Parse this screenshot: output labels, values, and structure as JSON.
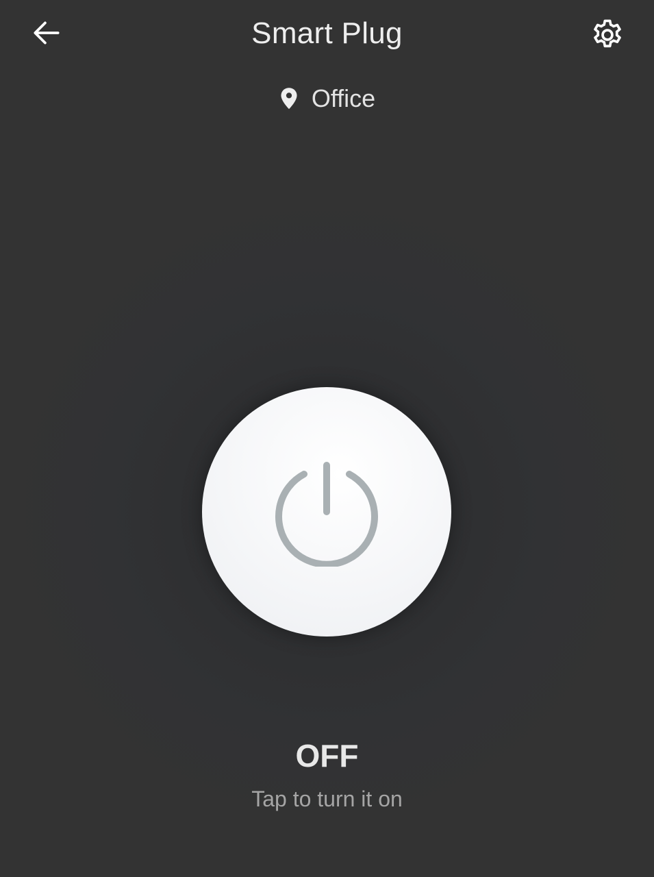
{
  "header": {
    "title": "Smart Plug",
    "back_icon": "arrow-left-icon",
    "settings_icon": "gear-icon"
  },
  "location": {
    "icon": "map-pin-icon",
    "label": "Office"
  },
  "power": {
    "icon": "power-icon",
    "state": "OFF",
    "hint": "Tap to turn it on"
  },
  "colors": {
    "background": "#333333",
    "button_face": "#f5f6f8",
    "power_icon": "#a9b0b3",
    "hint_text": "#a5a5a5"
  }
}
